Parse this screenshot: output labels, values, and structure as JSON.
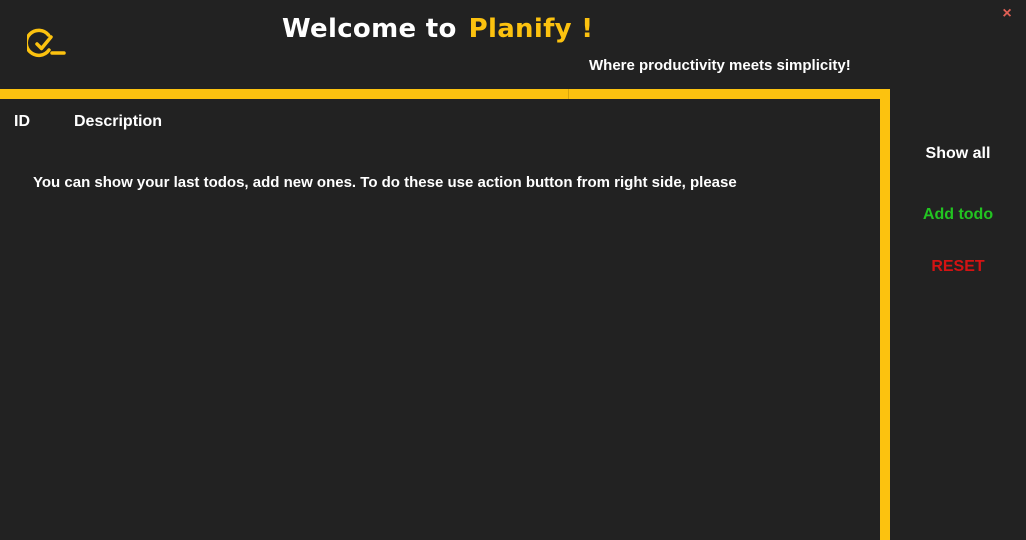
{
  "app": {
    "title_prefix": "Welcome to",
    "brand": "Planify !",
    "subtitle": "Where productivity meets simplicity!",
    "close_label": "×"
  },
  "icons": {
    "logo": "check-circle-icon",
    "close": "close-icon"
  },
  "table": {
    "columns": [
      "ID",
      "Description"
    ],
    "info": "You can show your last todos, add new ones. To do these use action button from right side, please"
  },
  "actions": {
    "show_all": {
      "label": "Show all",
      "color": "#ffffff"
    },
    "add_todo": {
      "label": "Add todo",
      "color": "#22c421"
    },
    "reset": {
      "label": "RESET",
      "color": "#d41313"
    }
  },
  "colors": {
    "background": "#222222",
    "accent": "#fcc20f",
    "text": "#ffffff",
    "close": "#e06055"
  }
}
